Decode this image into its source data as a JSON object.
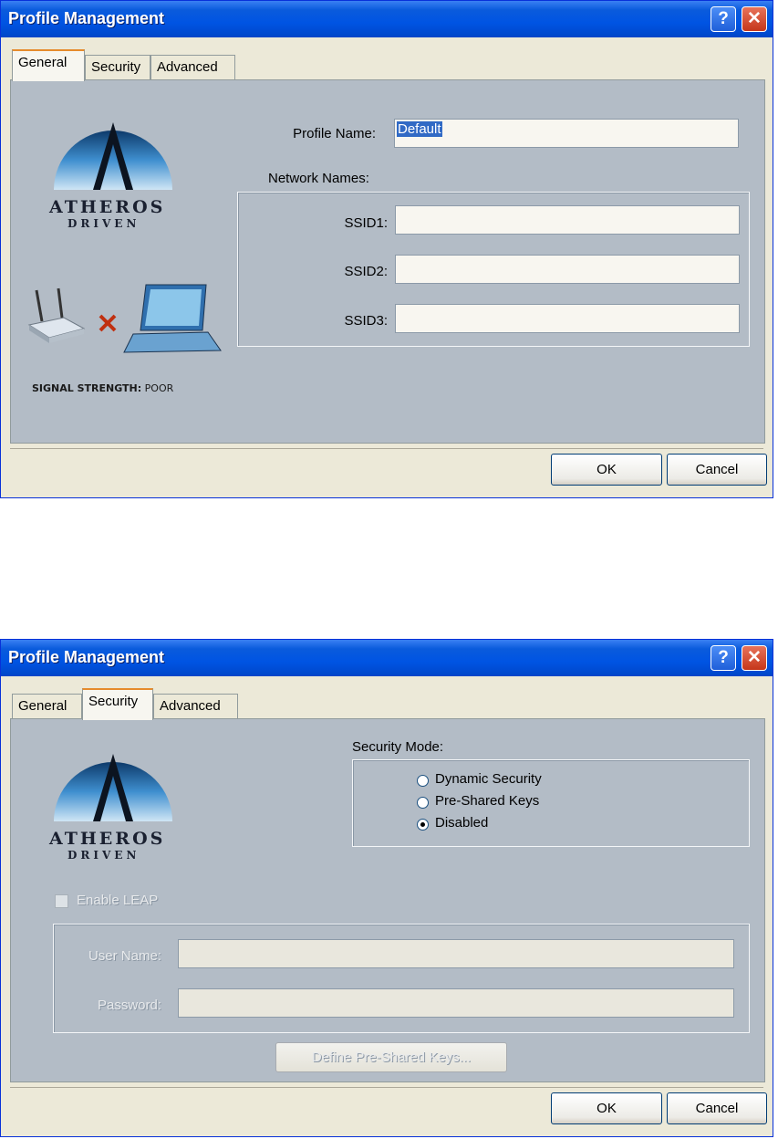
{
  "window_title": "Profile Management",
  "title_buttons": {
    "help": "?",
    "close": "✕"
  },
  "tabs": [
    "General",
    "Security",
    "Advanced"
  ],
  "logo": {
    "line1": "ATHEROS",
    "line2": "DRIVEN",
    "mark": "A"
  },
  "general": {
    "profile_name_label": "Profile Name:",
    "profile_name_value": "Default",
    "network_names_label": "Network Names:",
    "ssid1_label": "SSID1:",
    "ssid2_label": "SSID2:",
    "ssid3_label": "SSID3:",
    "ssid1_value": "",
    "ssid2_value": "",
    "ssid3_value": "",
    "signal_label": "SIGNAL STRENGTH:",
    "signal_value": "POOR"
  },
  "security": {
    "mode_label": "Security Mode:",
    "options": [
      "Dynamic Security",
      "Pre-Shared Keys",
      "Disabled"
    ],
    "selected": "Disabled",
    "enable_leap_label": "Enable LEAP",
    "user_name_label": "User Name:",
    "password_label": "Password:",
    "define_keys_label": "Define Pre-Shared Keys..."
  },
  "buttons": {
    "ok": "OK",
    "cancel": "Cancel"
  },
  "colors": {
    "titlebar": "#0054e3",
    "panel": "#b3bcc6",
    "tab_highlight": "#e68b2c"
  }
}
